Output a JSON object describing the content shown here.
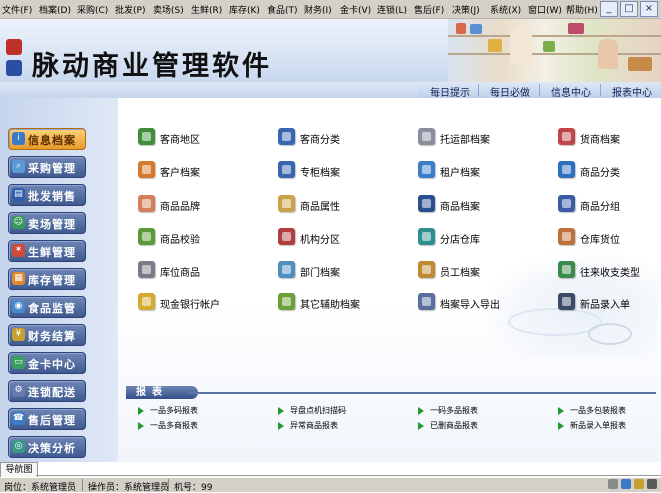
{
  "menubar": {
    "items": [
      "文件(F)",
      "档案(D)",
      "采购(C)",
      "批发(P)",
      "卖场(S)",
      "生鲜(R)",
      "库存(K)",
      "食品(T)",
      "财务(I)",
      "金卡(V)",
      "连锁(L)",
      "售后(F)",
      "决策(J)",
      "系统(X)",
      "窗口(W)",
      "帮助(H)"
    ],
    "window_buttons": [
      "_",
      "□",
      "×"
    ]
  },
  "header": {
    "title": "脉动商业管理软件",
    "quick_links": [
      "每日提示",
      "每日必做",
      "信息中心",
      "报表中心"
    ]
  },
  "sidebar": {
    "items": [
      {
        "label": "信息档案",
        "icon": "info-archive-icon",
        "active": true
      },
      {
        "label": "采购管理",
        "icon": "purchase-icon",
        "active": false
      },
      {
        "label": "批发销售",
        "icon": "wholesale-icon",
        "active": false
      },
      {
        "label": "卖场管理",
        "icon": "store-icon",
        "active": false
      },
      {
        "label": "生鲜管理",
        "icon": "fresh-icon",
        "active": false
      },
      {
        "label": "库存管理",
        "icon": "inventory-icon",
        "active": false
      },
      {
        "label": "食品监管",
        "icon": "food-icon",
        "active": false
      },
      {
        "label": "财务结算",
        "icon": "finance-icon",
        "active": false
      },
      {
        "label": "金卡中心",
        "icon": "card-icon",
        "active": false
      },
      {
        "label": "连锁配送",
        "icon": "chain-icon",
        "active": false
      },
      {
        "label": "售后管理",
        "icon": "aftersale-icon",
        "active": false
      },
      {
        "label": "决策分析",
        "icon": "decision-icon",
        "active": false
      }
    ]
  },
  "main": {
    "items": [
      "客商地区",
      "客商分类",
      "托运部档案",
      "货商档案",
      "客户档案",
      "专柜档案",
      "租户档案",
      "商品分类",
      "商品品牌",
      "商品属性",
      "商品档案",
      "商品分组",
      "商品校验",
      "机构分区",
      "分店仓库",
      "仓库货位",
      "库位商品",
      "部门档案",
      "员工档案",
      "往来收支类型",
      "现金银行帐户",
      "其它辅助档案",
      "档案导入导出",
      "新品录入单"
    ],
    "item_colors": [
      "#3f8f3a",
      "#3a66b0",
      "#8a8fa0",
      "#c0454a",
      "#d47a2a",
      "#3a66b0",
      "#3c7fc8",
      "#2f6fbf",
      "#d27f5a",
      "#c9a24a",
      "#2a4f8f",
      "#3b5aa8",
      "#5a9a3a",
      "#b04040",
      "#2f8f8f",
      "#c0703a",
      "#7a7a8a",
      "#4f8fbf",
      "#c08a30",
      "#3a8a4a",
      "#d4aa30",
      "#6aa03a",
      "#5a6fa0",
      "#3a4a6a"
    ],
    "report_section": {
      "title": "报表",
      "items": [
        "一品多码报表",
        "导盘点机扫描码",
        "一码多品报表",
        "一品多包装报表",
        "一品多商报表",
        "异常商品报表",
        "已删商品报表",
        "新品录入单报表"
      ]
    }
  },
  "bottom": {
    "nav_tab": "导航图",
    "status": [
      "岗位：系统管理员",
      "操作员：系统管理员",
      "机号：99"
    ]
  },
  "colors": {
    "accent": "#3f5a90",
    "active_nav": "#e79a2a",
    "report_arrow": "#1e9a2e"
  }
}
